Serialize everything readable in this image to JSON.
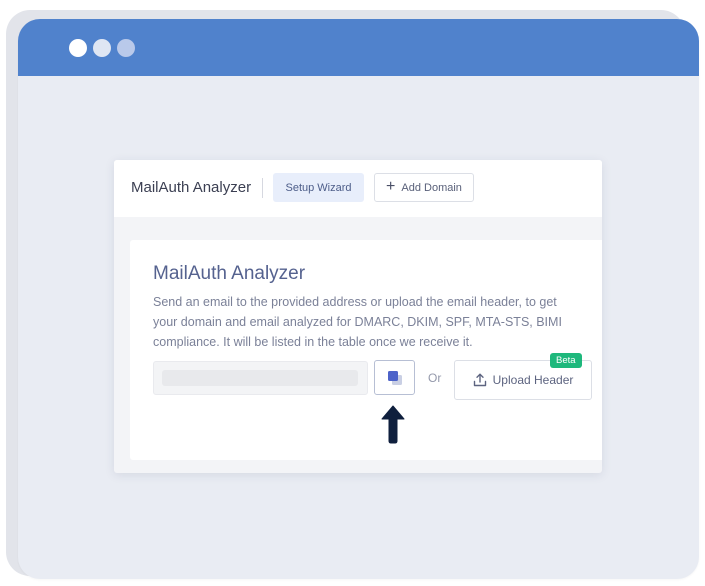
{
  "window": {
    "dots": [
      "close-dot",
      "minimize-dot",
      "maximize-dot"
    ]
  },
  "toolbar": {
    "app_title": "MailAuth Analyzer",
    "wizard_label": "Setup Wizard",
    "add_domain_label": "Add Domain",
    "add_icon": "+"
  },
  "card": {
    "title": "MailAuth Analyzer",
    "description": "Send an email to the provided address or upload the email header, to get your domain and email analyzed for DMARC, DKIM, SPF, MTA-STS, BIMI compliance. It will be listed in the table once we receive it.",
    "email_value": "",
    "or_label": "Or",
    "upload_label": "Upload Header",
    "beta_label": "Beta"
  },
  "colors": {
    "titlebar": "#5082cc",
    "accent": "#4d63c9",
    "beta": "#1eb87c",
    "arrow": "#0f1f3d"
  },
  "icons": {
    "copy": "copy-icon",
    "upload": "upload-icon",
    "pointer": "arrow-up-icon"
  }
}
